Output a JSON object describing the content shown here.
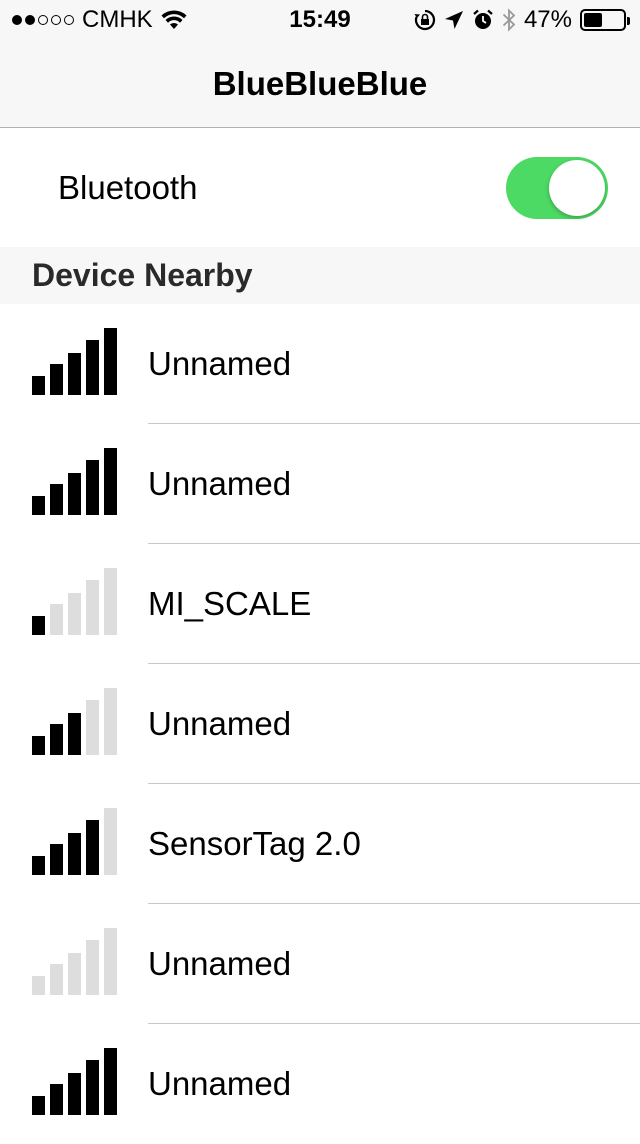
{
  "status_bar": {
    "carrier": "CMHK",
    "time": "15:49",
    "battery_percent": "47%",
    "battery_level": 0.47,
    "signal_dots_filled": 2,
    "signal_dots_total": 5
  },
  "nav": {
    "title": "BlueBlueBlue"
  },
  "bluetooth": {
    "label": "Bluetooth",
    "enabled": true,
    "toggle_color": "#4cd964"
  },
  "section": {
    "title": "Device Nearby"
  },
  "devices": [
    {
      "name": "Unnamed",
      "signal_bars": 5
    },
    {
      "name": "Unnamed",
      "signal_bars": 5
    },
    {
      "name": "MI_SCALE",
      "signal_bars": 1
    },
    {
      "name": "Unnamed",
      "signal_bars": 3
    },
    {
      "name": "SensorTag 2.0",
      "signal_bars": 4
    },
    {
      "name": "Unnamed",
      "signal_bars": 0
    },
    {
      "name": "Unnamed",
      "signal_bars": 5
    }
  ]
}
